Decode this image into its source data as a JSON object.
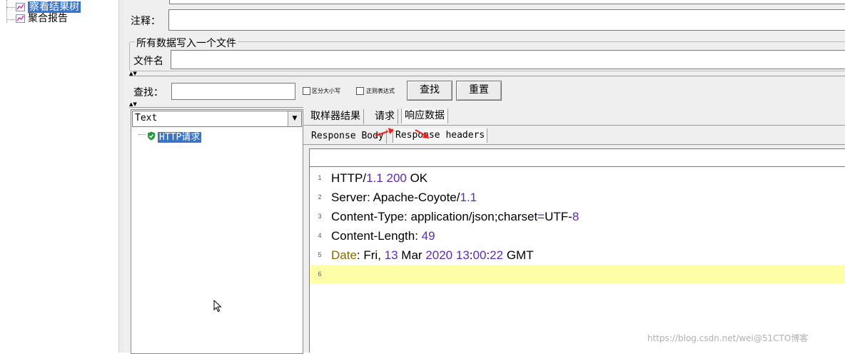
{
  "tree": {
    "items": [
      {
        "label": "察看结果树",
        "selected": true,
        "icon": "chart-icon"
      },
      {
        "label": "聚合报告",
        "selected": false,
        "icon": "chart-icon"
      }
    ]
  },
  "form": {
    "comment_label": "注释：",
    "file_group_title": "所有数据写入一个文件",
    "filename_label": "文件名"
  },
  "search": {
    "label": "查找：",
    "case_label": "区分大小写",
    "regex_label": "正则表达式",
    "find_button": "查找",
    "reset_button": "重置"
  },
  "result_tree": {
    "renderer_value": "Text",
    "items": [
      {
        "label": "HTTP请求",
        "status": "success",
        "icon": "shield-check-icon"
      }
    ]
  },
  "tabs": [
    "取样器结果",
    "请求",
    "响应数据"
  ],
  "subtabs": [
    "Response Body",
    "Response headers"
  ],
  "headers_lines": [
    {
      "n": "1",
      "parts": [
        [
          "HTTP/",
          "t"
        ],
        [
          "1.1",
          "n"
        ],
        [
          " ",
          "t"
        ],
        [
          "200",
          "n"
        ],
        [
          " OK",
          "t"
        ]
      ]
    },
    {
      "n": "2",
      "parts": [
        [
          "Server: Apache-Coyote/",
          "t"
        ],
        [
          "1.1",
          "n"
        ]
      ]
    },
    {
      "n": "3",
      "parts": [
        [
          "Content-Type: application/json;charset",
          "t"
        ],
        [
          "=",
          "n"
        ],
        [
          "UTF-",
          "t"
        ],
        [
          "8",
          "n"
        ]
      ]
    },
    {
      "n": "4",
      "parts": [
        [
          "Content-Length: ",
          "t"
        ],
        [
          "49",
          "n"
        ]
      ]
    },
    {
      "n": "5",
      "parts": [
        [
          "Date",
          "k"
        ],
        [
          ": Fri, ",
          "t"
        ],
        [
          "13",
          "n"
        ],
        [
          " Mar ",
          "t"
        ],
        [
          "2020",
          "n"
        ],
        [
          " ",
          "t"
        ],
        [
          "13",
          "n"
        ],
        [
          ":",
          "t"
        ],
        [
          "00",
          "n"
        ],
        [
          ":",
          "t"
        ],
        [
          "22",
          "n"
        ],
        [
          " GMT",
          "t"
        ]
      ]
    },
    {
      "n": "6",
      "parts": []
    }
  ],
  "watermark": "https://blog.csdn.net/wei@51CTO博客"
}
